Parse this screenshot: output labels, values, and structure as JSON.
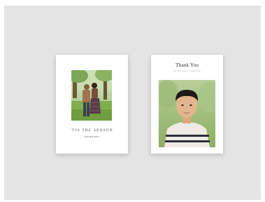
{
  "cards": [
    {
      "heading": "'TIS THE SEASON",
      "subtext": "love and cheer",
      "photo": "family-photo"
    },
    {
      "heading": "Thank You",
      "subtext": "for all your kindness",
      "photo": "boy-portrait-photo"
    }
  ],
  "colors": {
    "backdrop": "#e4e4e4",
    "card": "#ffffff",
    "text": "#333333"
  }
}
